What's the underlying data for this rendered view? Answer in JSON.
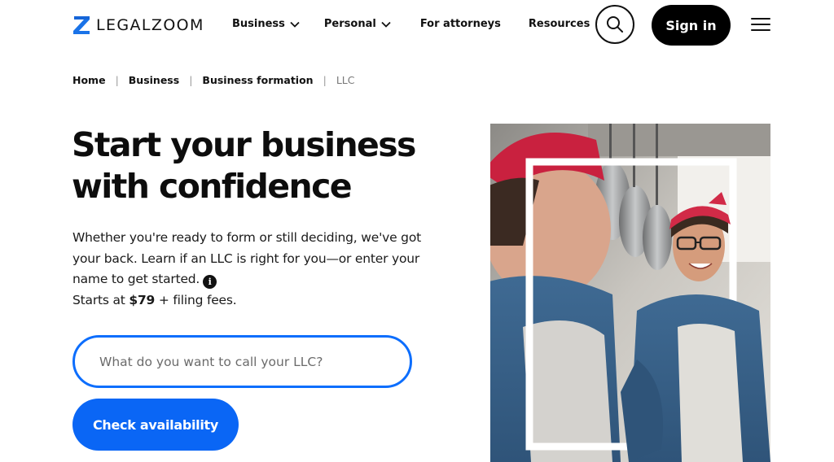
{
  "header": {
    "logo_text": "LEGALZOOM",
    "nav": [
      {
        "label": "Business",
        "has_dropdown": true
      },
      {
        "label": "Personal",
        "has_dropdown": true
      },
      {
        "label": "For attorneys",
        "has_dropdown": false
      },
      {
        "label": "Resources",
        "has_dropdown": false
      }
    ],
    "sign_in_label": "Sign in",
    "search_icon": "search-icon",
    "menu_icon": "hamburger-menu-icon"
  },
  "breadcrumb": [
    "Home",
    "Business",
    "Business formation",
    "LLC"
  ],
  "hero": {
    "title_line1": "Start your business",
    "title_line2": "with confidence",
    "description": "Whether you're ready to form or still deciding, we've got your back. Learn if an LLC is right for you—or enter your name to get started.",
    "price_prefix": "Starts at ",
    "price": "$79",
    "price_suffix": " + filing fees.",
    "input_placeholder": "What do you want to call your LLC?",
    "cta_label": "Check availability"
  },
  "colors": {
    "accent_blue": "#0a66f5",
    "input_border": "#0d6efd",
    "logo_blue": "#1a73e8",
    "black": "#000000"
  }
}
